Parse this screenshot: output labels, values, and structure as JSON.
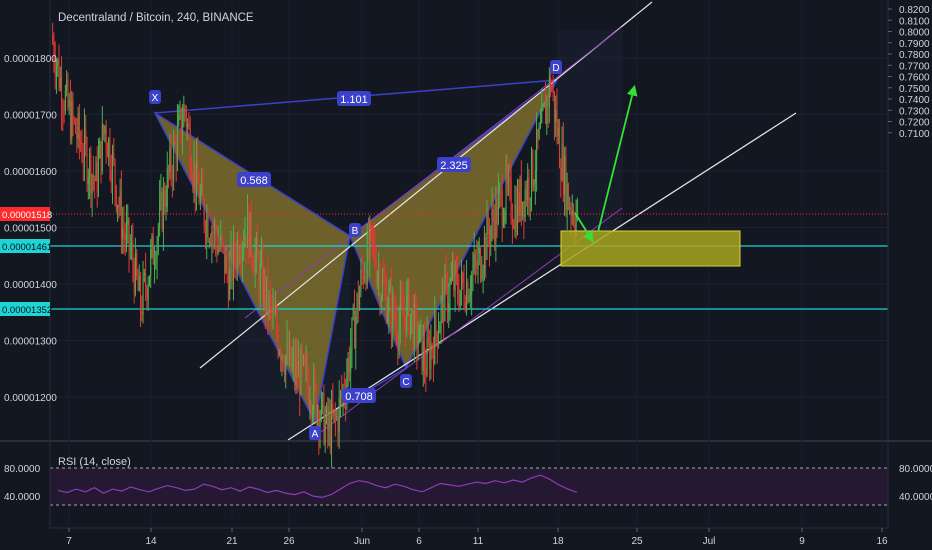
{
  "header": {
    "symbol": "Decentraland / Bitcoin",
    "interval": "240",
    "exchange": "BINANCE"
  },
  "colors": {
    "background": "#131722",
    "up": "#4caf50",
    "down": "#e53935",
    "pattern_fill": "#8c7a2e",
    "pattern_edge": "#3b41c9",
    "channel": "#e6e6e6",
    "price_line": "#1fd4d4",
    "current_price": "#ff2b2b",
    "target_zone": "#a8a61e",
    "arrow": "#33e033",
    "rsi": "#8e3db3",
    "rsi_band": "#241833"
  },
  "chart_data": [
    {
      "type": "candlestick",
      "title": "Decentraland / Bitcoin, 240, BINANCE",
      "left_axis": {
        "ticks": [
          "0.00001800",
          "0.00001700",
          "0.00001600",
          "0.00001500",
          "0.00001400",
          "0.00001300",
          "0.00001200"
        ],
        "values": [
          1.8e-05,
          1.7e-05,
          1.6e-05,
          1.5e-05,
          1.4e-05,
          1.3e-05,
          1.2e-05
        ]
      },
      "right_axis": {
        "ticks": [
          "0.8200",
          "0.8100",
          "0.8000",
          "0.7900",
          "0.7800",
          "0.7700",
          "0.7600",
          "0.7500",
          "0.7400",
          "0.7300",
          "0.7200",
          "0.7100"
        ],
        "values": [
          0.82,
          0.81,
          0.8,
          0.79,
          0.78,
          0.77,
          0.76,
          0.75,
          0.74,
          0.73,
          0.72,
          0.71
        ]
      },
      "x_axis": {
        "ticks": [
          "7",
          "14",
          "21",
          "26",
          "Jun",
          "6",
          "11",
          "18",
          "25",
          "Jul",
          "9",
          "16"
        ]
      },
      "price_labels": [
        {
          "text": "0.00001518",
          "value": 1.518e-05,
          "role": "current"
        },
        {
          "text": "0.00001461",
          "value": 1.461e-05,
          "role": "level"
        },
        {
          "text": "0.00001352",
          "value": 1.352e-05,
          "role": "level"
        }
      ],
      "harmonic_points": [
        {
          "label": "X",
          "value": 1.71e-05
        },
        {
          "label": "A",
          "value": 1.138e-05
        },
        {
          "label": "B",
          "value": 1.473e-05
        },
        {
          "label": "C",
          "value": 1.256e-05
        },
        {
          "label": "D",
          "value": 1.765e-05
        }
      ],
      "ratios": [
        "1.101",
        "0.568",
        "2.325",
        "0.708"
      ],
      "close_path": [
        1.84e-05,
        1.76e-05,
        1.7e-05,
        1.66e-05,
        1.62e-05,
        1.58e-05,
        1.68e-05,
        1.6e-05,
        1.5e-05,
        1.45e-05,
        1.36e-05,
        1.43e-05,
        1.5e-05,
        1.58e-05,
        1.65e-05,
        1.71e-05,
        1.6e-05,
        1.53e-05,
        1.5e-05,
        1.46e-05,
        1.41e-05,
        1.48e-05,
        1.5e-05,
        1.44e-05,
        1.38e-05,
        1.33e-05,
        1.28e-05,
        1.25e-05,
        1.24e-05,
        1.22e-05,
        1.18e-05,
        1.14e-05,
        1.16e-05,
        1.23e-05,
        1.33e-05,
        1.43e-05,
        1.47e-05,
        1.4e-05,
        1.36e-05,
        1.33e-05,
        1.36e-05,
        1.31e-05,
        1.26e-05,
        1.31e-05,
        1.37e-05,
        1.4e-05,
        1.39e-05,
        1.41e-05,
        1.44e-05,
        1.49e-05,
        1.53e-05,
        1.56e-05,
        1.53e-05,
        1.56e-05,
        1.6e-05,
        1.67e-05,
        1.76e-05,
        1.64e-05,
        1.55e-05,
        1.52e-05
      ]
    },
    {
      "type": "line",
      "title": "RSI (14, close)",
      "y_ticks_left": [
        "80.0000",
        "40.0000"
      ],
      "y_ticks_right": [
        "80.0000",
        "40.0000"
      ],
      "y_values": [
        80,
        40
      ],
      "band": [
        70,
        30
      ],
      "values": [
        48,
        45,
        50,
        46,
        52,
        44,
        50,
        47,
        53,
        49,
        46,
        51,
        55,
        52,
        48,
        50,
        57,
        54,
        49,
        52,
        47,
        53,
        50,
        45,
        48,
        44,
        42,
        46,
        40,
        38,
        42,
        50,
        58,
        62,
        60,
        55,
        52,
        57,
        54,
        49,
        46,
        52,
        58,
        56,
        54,
        57,
        60,
        58,
        62,
        59,
        63,
        60,
        66,
        70,
        64,
        56,
        50,
        45
      ]
    }
  ]
}
